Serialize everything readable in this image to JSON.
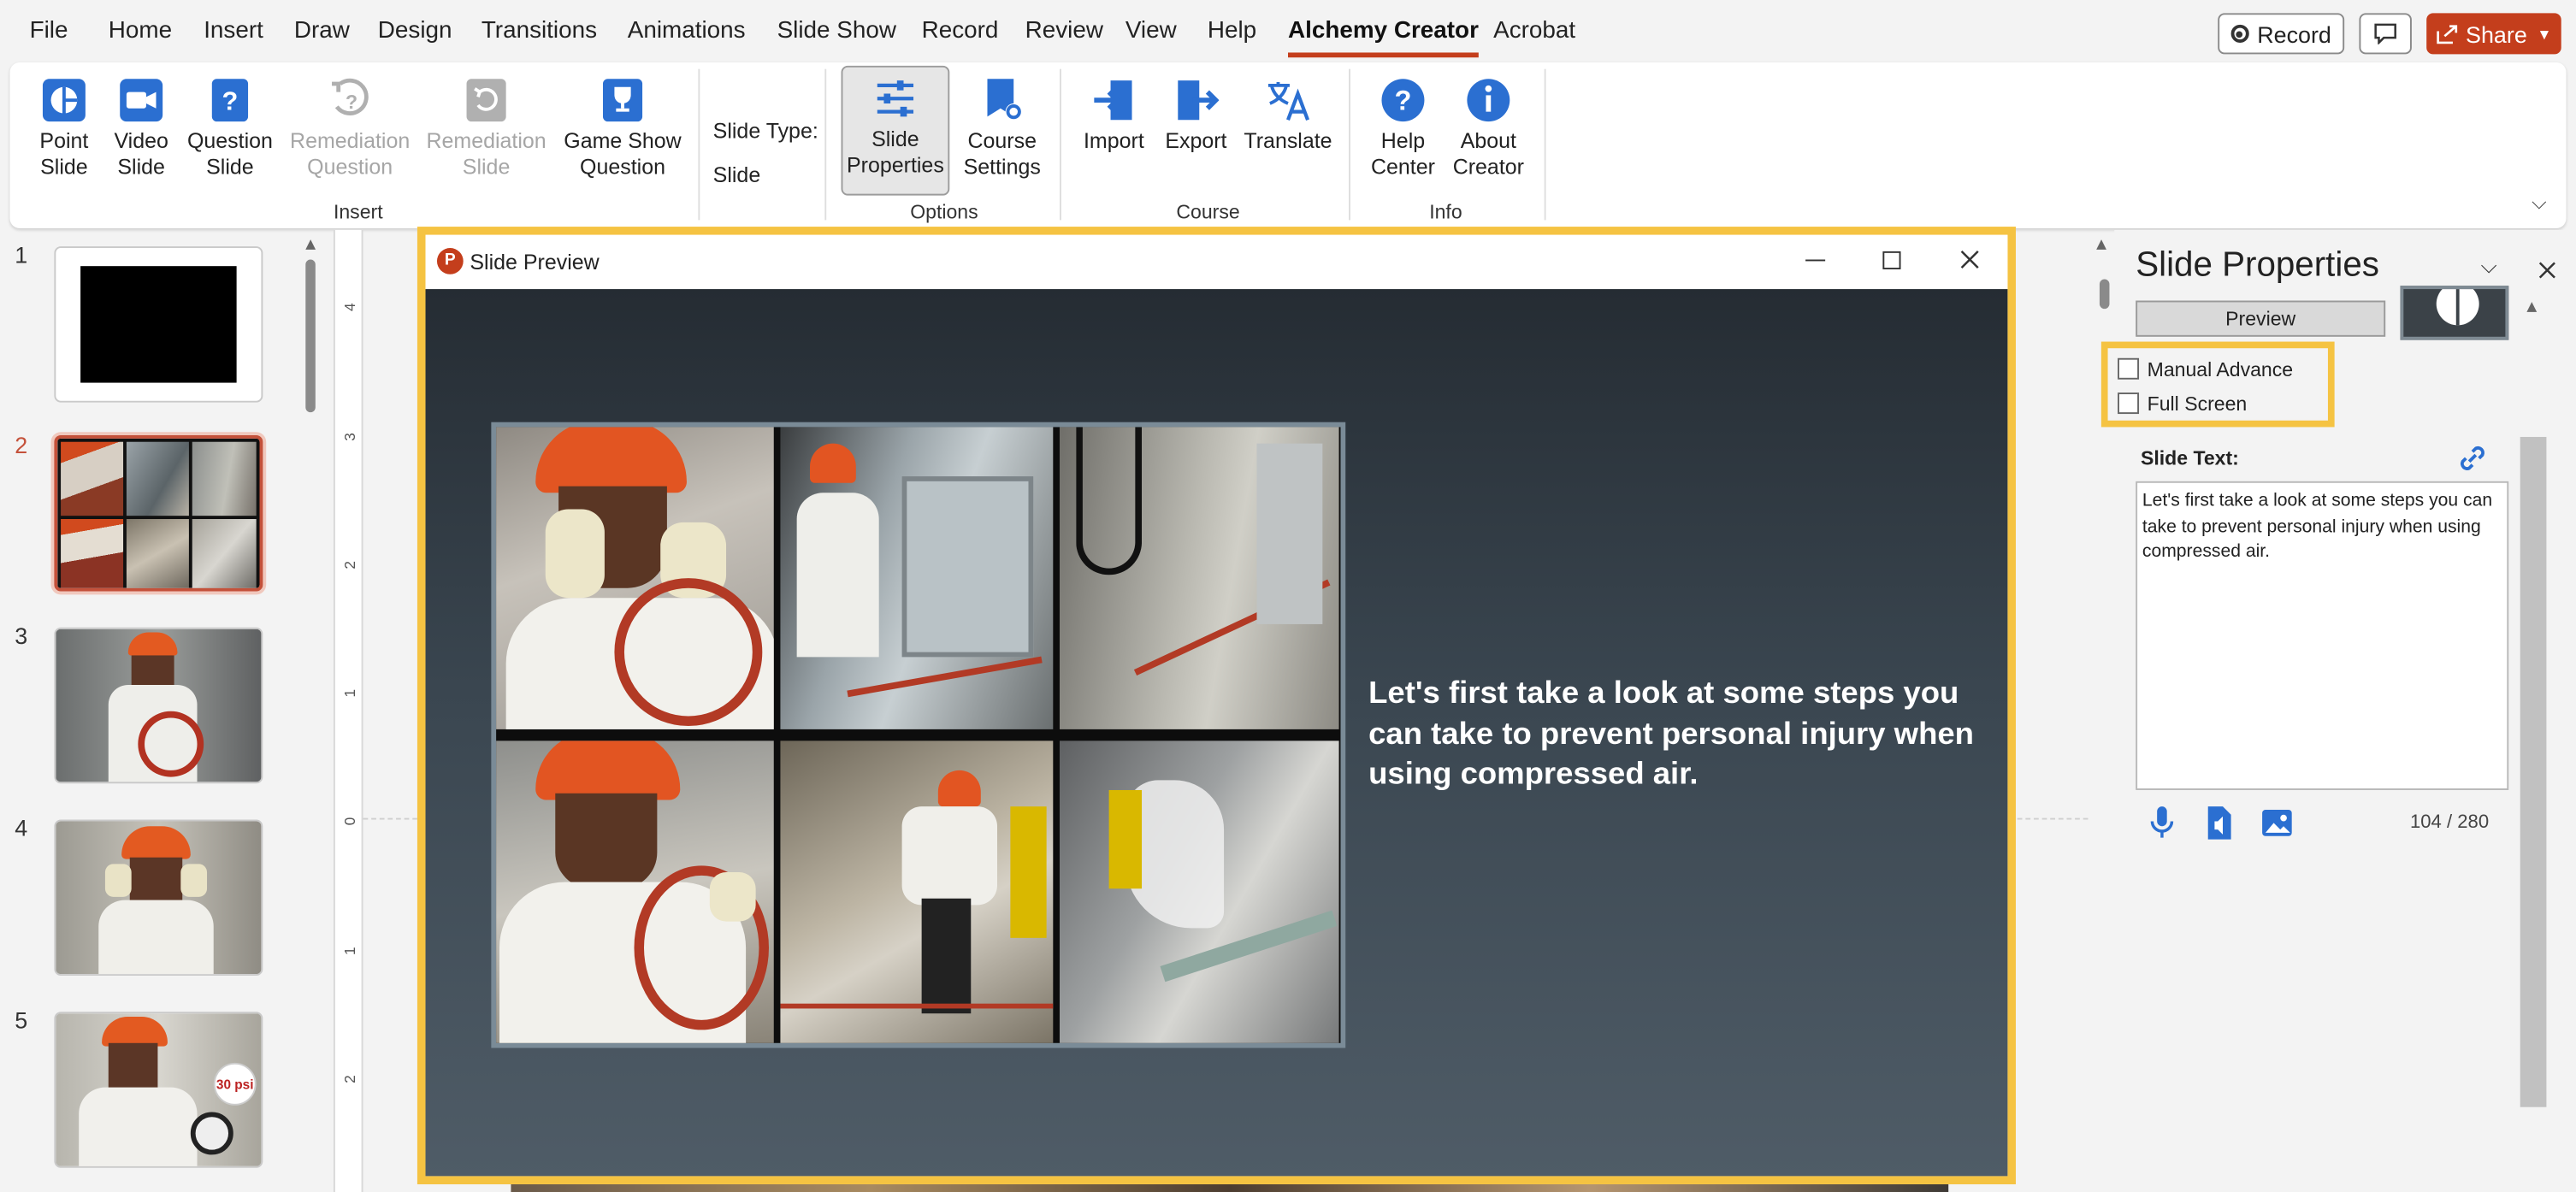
{
  "menu": {
    "items": [
      "File",
      "Home",
      "Insert",
      "Draw",
      "Design",
      "Transitions",
      "Animations",
      "Slide Show",
      "Record",
      "Review",
      "View",
      "Help",
      "Alchemy Creator",
      "Acrobat"
    ],
    "active": "Alchemy Creator"
  },
  "topright": {
    "record_label": "Record",
    "share_label": "Share"
  },
  "ribbon": {
    "insert": {
      "point_slide": [
        "Point",
        "Slide"
      ],
      "video_slide": [
        "Video",
        "Slide"
      ],
      "question_slide": [
        "Question",
        "Slide"
      ],
      "remediation_question": [
        "Remediation",
        "Question"
      ],
      "remediation_slide": [
        "Remediation",
        "Slide"
      ],
      "game_show_question": [
        "Game Show",
        "Question"
      ],
      "group": "Insert"
    },
    "slide_type": {
      "label": "Slide Type:",
      "value": "Slide"
    },
    "options": {
      "slide_properties": [
        "Slide",
        "Properties"
      ],
      "course_settings": [
        "Course",
        "Settings"
      ],
      "group": "Options"
    },
    "course": {
      "import": "Import",
      "export": "Export",
      "translate": "Translate",
      "group": "Course"
    },
    "info": {
      "help_center": [
        "Help",
        "Center"
      ],
      "about_creator": [
        "About",
        "Creator"
      ],
      "group": "Info"
    }
  },
  "slides": {
    "numbers": [
      "1",
      "2",
      "3",
      "4",
      "5"
    ],
    "selected": "2"
  },
  "ruler": {
    "numbers": [
      "4",
      "3",
      "2",
      "1",
      "0",
      "1",
      "2"
    ]
  },
  "preview_window": {
    "title": "Slide Preview",
    "slide_text": "Let's first take a look at some steps you can take to prevent personal injury when using compressed air."
  },
  "thumb5_badge": "30 psi",
  "properties": {
    "title": "Slide Properties",
    "preview_button": "Preview",
    "manual_advance": "Manual Advance",
    "full_screen": "Full Screen",
    "manual_advance_checked": false,
    "full_screen_checked": false,
    "slide_text_label": "Slide Text:",
    "slide_text_value": "Let's first take a look at some steps you can take to prevent personal injury when using compressed air.",
    "char_count": "104 / 280"
  },
  "colors": {
    "accent": "#c43e1c",
    "ribbon_icon_blue": "#2b6fd1",
    "highlight": "#f5c342"
  }
}
